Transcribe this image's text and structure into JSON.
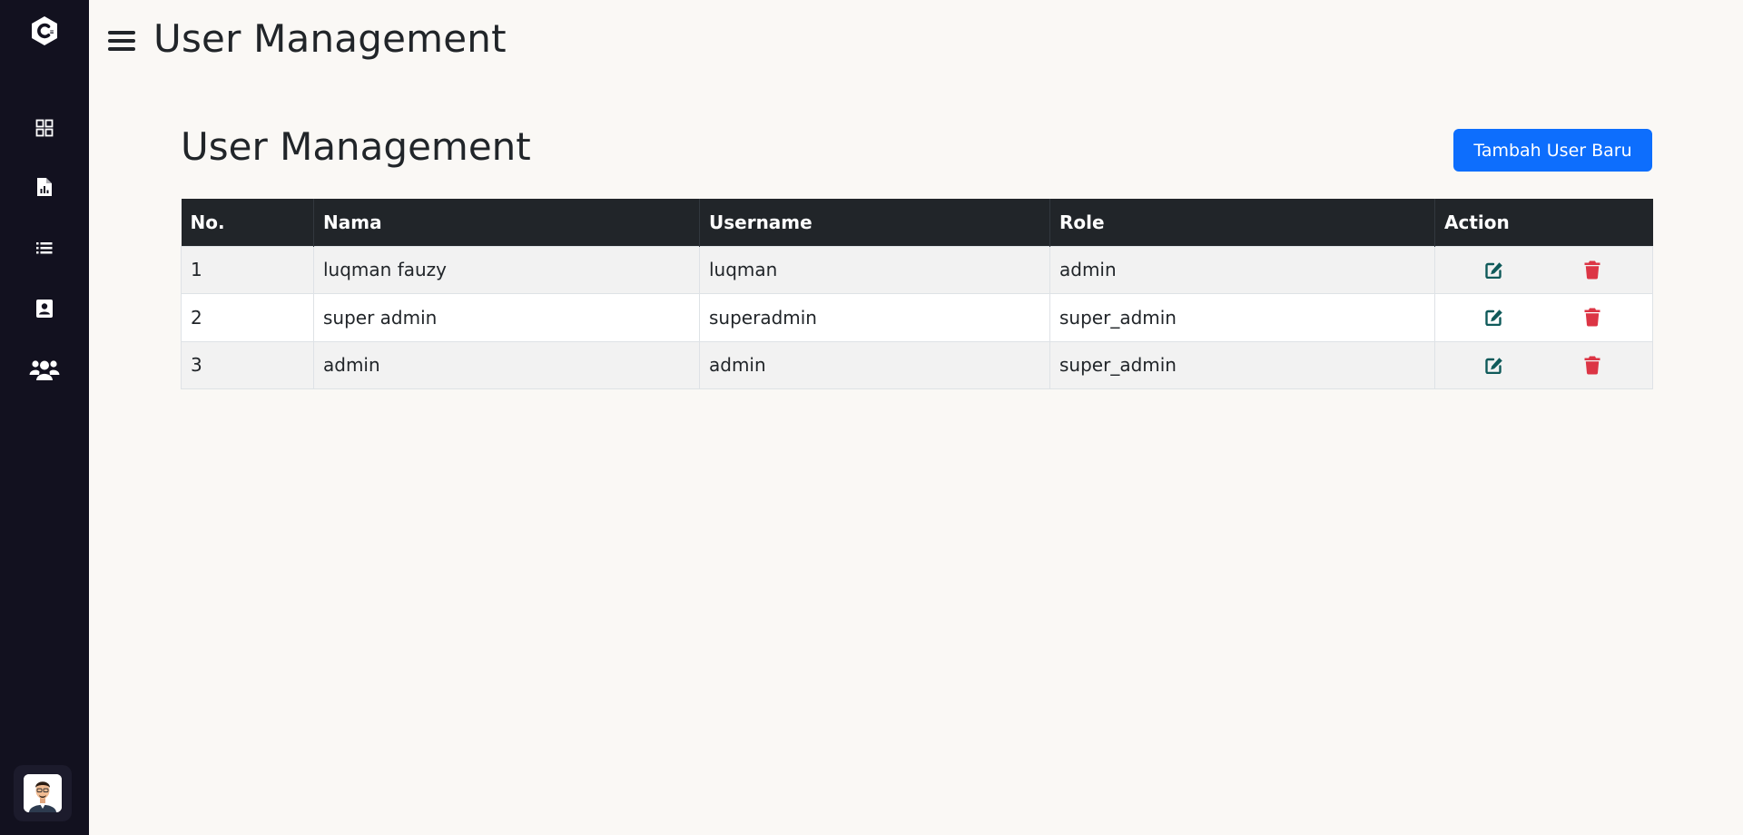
{
  "app": {
    "top_title": "User Management"
  },
  "sidebar": {
    "items": [
      {
        "icon": "dashboard-grid-icon"
      },
      {
        "icon": "report-file-icon"
      },
      {
        "icon": "list-icon"
      },
      {
        "icon": "contact-card-icon"
      },
      {
        "icon": "users-group-icon"
      }
    ]
  },
  "main": {
    "page_title": "User Management",
    "add_button_label": "Tambah User Baru",
    "table": {
      "headers": [
        "No.",
        "Nama",
        "Username",
        "Role",
        "Action"
      ],
      "rows": [
        {
          "no": "1",
          "nama": "luqman fauzy",
          "username": "luqman",
          "role": "admin"
        },
        {
          "no": "2",
          "nama": "super admin",
          "username": "superadmin",
          "role": "super_admin"
        },
        {
          "no": "3",
          "nama": "admin",
          "username": "admin",
          "role": "super_admin"
        }
      ]
    }
  },
  "colors": {
    "sidebar_bg": "#12111f",
    "page_bg": "#faf8f5",
    "primary": "#0d6efd",
    "table_header_bg": "#212529",
    "edit_icon": "#0f5a5a",
    "delete_icon": "#dc3545"
  }
}
